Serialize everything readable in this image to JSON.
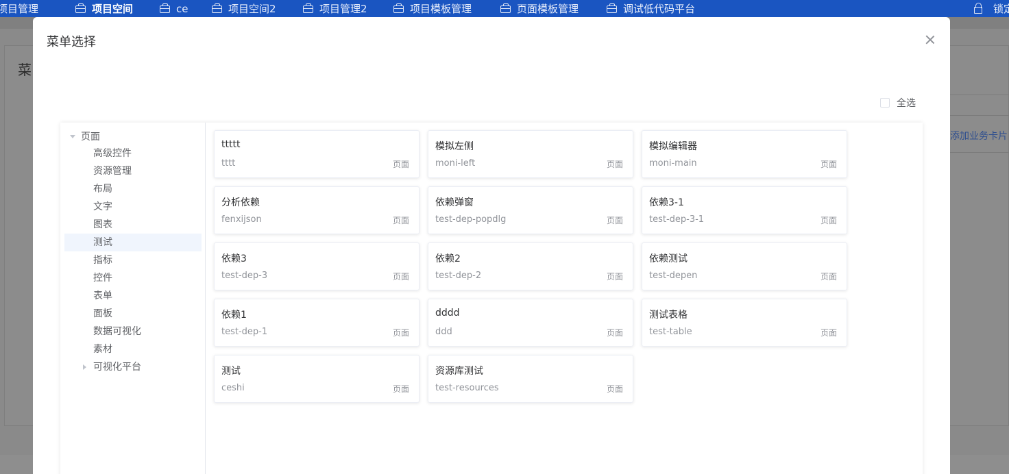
{
  "topnav": {
    "tabs": [
      {
        "label": "项目管理",
        "icon": "briefcase-icon",
        "active": false
      },
      {
        "label": "项目空间",
        "icon": "briefcase-icon",
        "active": true
      },
      {
        "label": "ce",
        "icon": "briefcase-icon",
        "active": false
      },
      {
        "label": "项目空间2",
        "icon": "briefcase-icon",
        "active": false
      },
      {
        "label": "项目管理2",
        "icon": "briefcase-icon",
        "active": false
      },
      {
        "label": "项目模板管理",
        "icon": "briefcase-icon",
        "active": false
      },
      {
        "label": "页面模板管理",
        "icon": "briefcase-icon",
        "active": false
      },
      {
        "label": "调试低代码平台",
        "icon": "briefcase-icon",
        "active": false
      }
    ],
    "lock_label": "锁定",
    "lock_icon": "lock-icon"
  },
  "background": {
    "left_title": "菜",
    "right_link": "添加业务卡片"
  },
  "dialog": {
    "title": "菜单选择",
    "close_icon": "close-icon",
    "select_all_label": "全选",
    "tree": {
      "root": "页面",
      "items": [
        "高级控件",
        "资源管理",
        "布局",
        "文字",
        "图表",
        "测试",
        "指标",
        "控件",
        "表单",
        "面板",
        "数据可视化",
        "素材",
        "可视化平台"
      ],
      "selected": "测试",
      "collapsed_with_children": "可视化平台"
    },
    "cards": [
      {
        "title": "ttttt",
        "code": "tttt",
        "type": "页面"
      },
      {
        "title": "模拟左侧",
        "code": "moni-left",
        "type": "页面"
      },
      {
        "title": "模拟编辑器",
        "code": "moni-main",
        "type": "页面"
      },
      {
        "title": "分析依赖",
        "code": "fenxijson",
        "type": "页面"
      },
      {
        "title": "依赖弹窗",
        "code": "test-dep-popdlg",
        "type": "页面"
      },
      {
        "title": "依赖3-1",
        "code": "test-dep-3-1",
        "type": "页面"
      },
      {
        "title": "依赖3",
        "code": "test-dep-3",
        "type": "页面"
      },
      {
        "title": "依赖2",
        "code": "test-dep-2",
        "type": "页面"
      },
      {
        "title": "依赖测试",
        "code": "test-depen",
        "type": "页面"
      },
      {
        "title": "依赖1",
        "code": "test-dep-1",
        "type": "页面"
      },
      {
        "title": "dddd",
        "code": "ddd",
        "type": "页面"
      },
      {
        "title": "测试表格",
        "code": "test-table",
        "type": "页面"
      },
      {
        "title": "测试",
        "code": "ceshi",
        "type": "页面"
      },
      {
        "title": "资源库测试",
        "code": "test-resources",
        "type": "页面"
      }
    ]
  },
  "colors": {
    "nav_bg": "#1a55c1",
    "selected_tree_bg": "#f0f5fd",
    "overlay": "#808080"
  }
}
